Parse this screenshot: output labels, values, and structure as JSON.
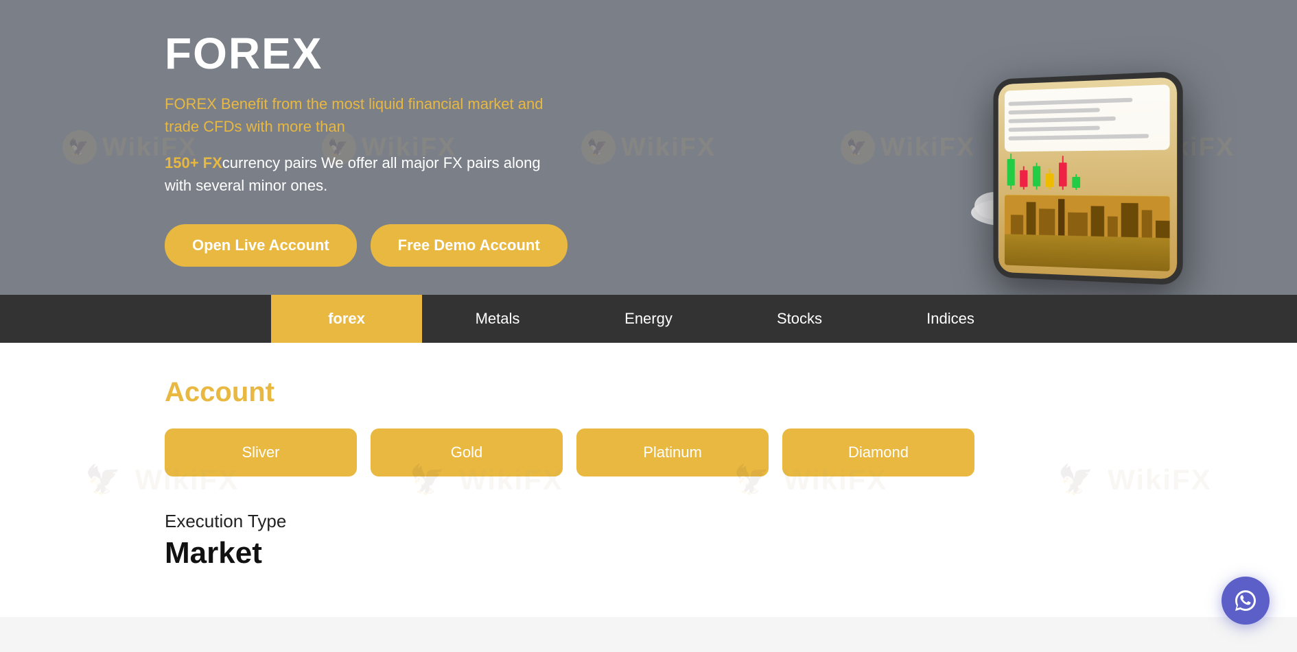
{
  "hero": {
    "title": "FOREX",
    "subtitle": "FOREX Benefit from the most liquid financial market and trade CFDs with more than",
    "description_highlight": "150+ FX",
    "description_rest": "currency pairs We offer all major FX pairs along with several minor ones.",
    "btn_live": "Open Live Account",
    "btn_demo": "Free Demo Account"
  },
  "tabs": [
    {
      "id": "forex",
      "label": "forex",
      "active": true
    },
    {
      "id": "metals",
      "label": "Metals",
      "active": false
    },
    {
      "id": "energy",
      "label": "Energy",
      "active": false
    },
    {
      "id": "stocks",
      "label": "Stocks",
      "active": false
    },
    {
      "id": "indices",
      "label": "Indices",
      "active": false
    }
  ],
  "account": {
    "title": "Account",
    "buttons": [
      {
        "id": "sliver",
        "label": "Sliver"
      },
      {
        "id": "gold",
        "label": "Gold"
      },
      {
        "id": "platinum",
        "label": "Platinum"
      },
      {
        "id": "diamond",
        "label": "Diamond"
      }
    ]
  },
  "execution": {
    "label": "Execution Type",
    "value": "Market"
  },
  "watermark": {
    "text": "WikiFX"
  },
  "chat": {
    "label": "chat-support"
  }
}
